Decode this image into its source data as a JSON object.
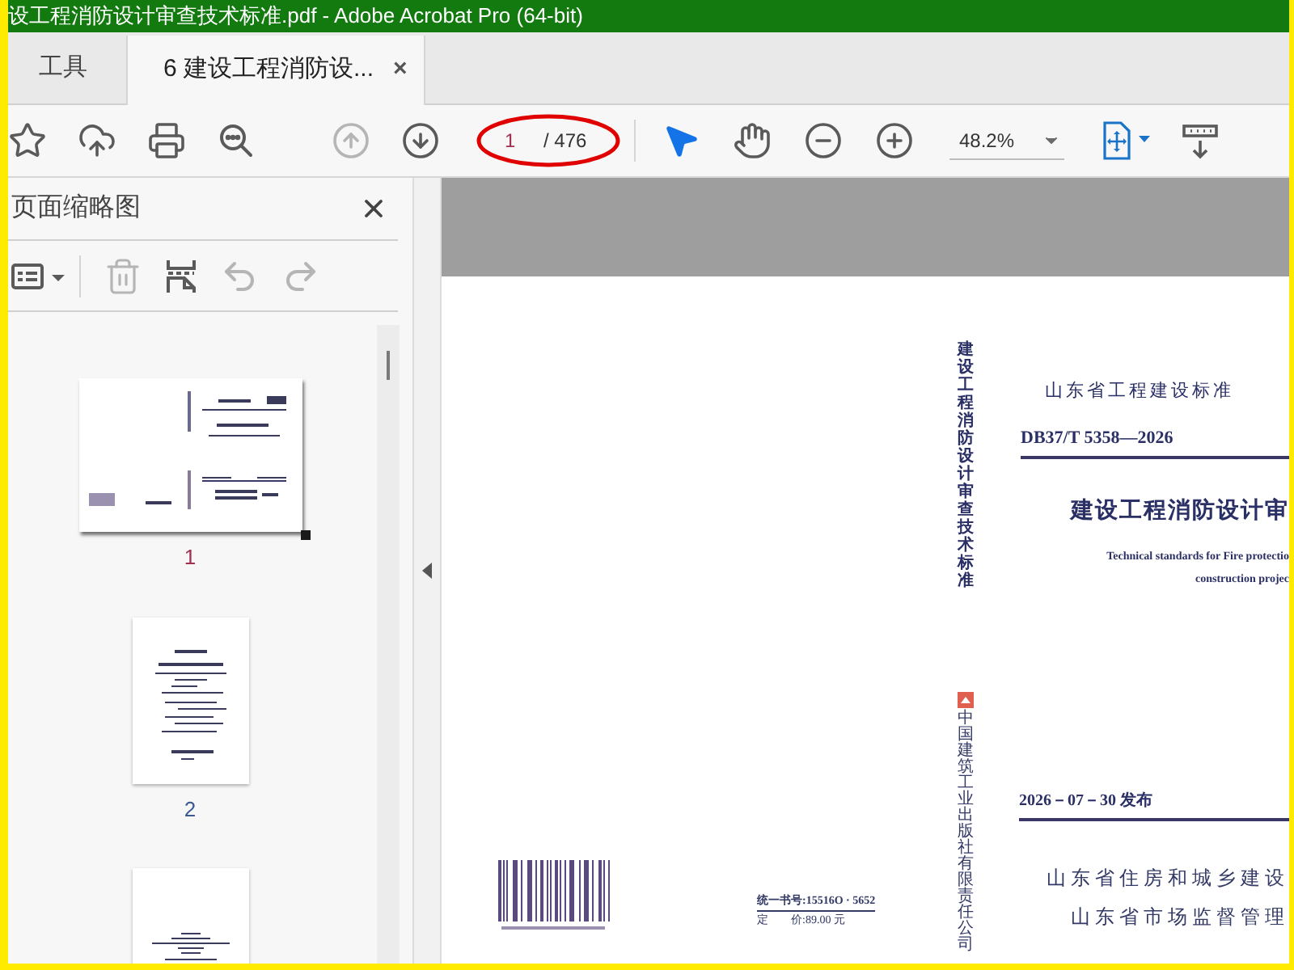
{
  "window": {
    "title": "设工程消防设计审查技术标准.pdf - Adobe Acrobat Pro (64-bit)"
  },
  "tabs": [
    {
      "label": "工具",
      "selected": false
    },
    {
      "label": "6 建设工程消防设...",
      "selected": true,
      "close": "×"
    }
  ],
  "toolbar": {
    "buttons": [
      {
        "kind": "bookmark",
        "disabled": false
      },
      {
        "kind": "upload",
        "disabled": false
      },
      {
        "kind": "print",
        "disabled": false
      },
      {
        "kind": "search",
        "disabled": false
      },
      {
        "kind": "prev",
        "disabled": true
      },
      {
        "kind": "next",
        "disabled": false
      }
    ],
    "page_field": {
      "value": "1",
      "total": "/ 476",
      "annotated": true
    },
    "tools": [
      {
        "kind": "select",
        "selected": true
      },
      {
        "kind": "hand",
        "selected": false
      },
      {
        "kind": "zoom_out",
        "selected": false
      },
      {
        "kind": "zoom_in",
        "selected": false
      }
    ],
    "zoom": {
      "value": "48.2%"
    }
  },
  "sidebar": {
    "title": "页面缩略图",
    "tools": [
      {
        "kind": "options",
        "disabled": false
      },
      {
        "kind": "delete",
        "disabled": true
      },
      {
        "kind": "insert",
        "disabled": false
      },
      {
        "kind": "undo",
        "disabled": true
      },
      {
        "kind": "redo",
        "disabled": true
      }
    ],
    "thumbnails": [
      {
        "kind": "cover",
        "label": "1",
        "selected": true
      },
      {
        "kind": "title",
        "label": "2",
        "selected": false
      },
      {
        "kind": "text",
        "selected": false
      }
    ]
  },
  "document": {
    "spine": "建设工程消防设计审查技术标准",
    "series": "山东省工程建设标准",
    "code": "DB37/T 5358—2026",
    "title": "建设工程消防设计审",
    "english": [
      "Technical standards for Fire protectio",
      "construction projec"
    ],
    "date": "2026－07－30 发布",
    "issuers": [
      "山东省住房和城乡建设",
      "山东省市场监督管理"
    ],
    "publisher": "中国建筑工业出版社有限责任公司",
    "book_number": "统一书号:15516O · 5652",
    "price": "定　　价:89.00 元"
  }
}
